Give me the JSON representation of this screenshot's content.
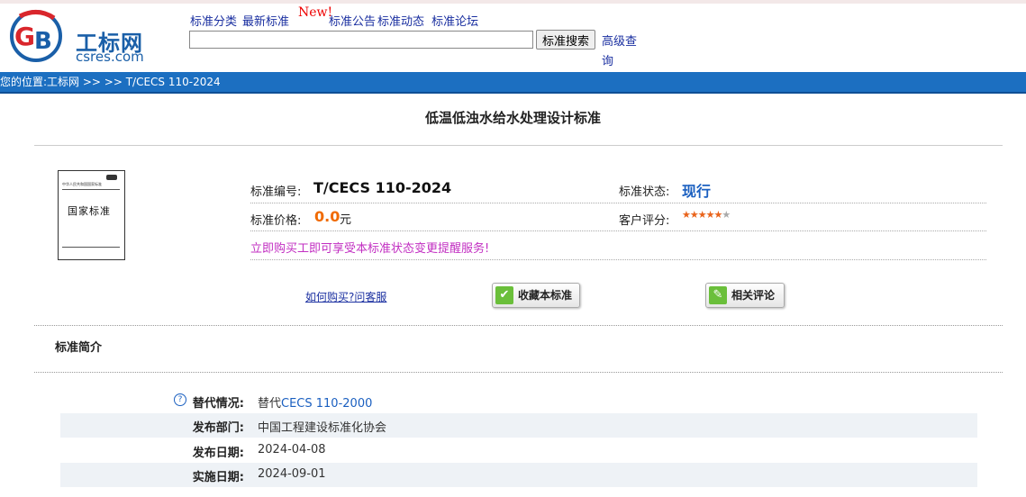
{
  "header": {
    "logo_text": "工标网",
    "logo_url": "csres.com",
    "nav": [
      "标准分类",
      "最新标准",
      "标准公告",
      "标准动态",
      "标准论坛"
    ],
    "new_badge": "New!",
    "search_value": "",
    "search_button": "标准搜索",
    "advanced_search": "高级查询"
  },
  "breadcrumb": "您的位置:工标网 >> >> T/CECS 110-2024",
  "page_title": "低温低浊水给水处理设计标准",
  "cover": {
    "header_text": "中华人民共和国国家标准",
    "big_text": "国家标准"
  },
  "info": {
    "code_label": "标准编号:",
    "code_value": "T/CECS 110-2024",
    "status_label": "标准状态:",
    "status_value": "现行",
    "price_label": "标准价格:",
    "price_value": "0.0",
    "price_unit": "元",
    "rating_label": "客户评分:",
    "rating": 4.5,
    "rating_max": 5,
    "promo": "立即购买工即可享受本标准状态变更提醒服务!"
  },
  "actions": {
    "how_to_buy": "如何购买?问客服",
    "favorite": "收藏本标准",
    "comments": "相关评论"
  },
  "section_title": "标准简介",
  "details": [
    {
      "label": "替代情况:",
      "prefix": "替代",
      "link": "CECS 110-2000"
    },
    {
      "label": "发布部门:",
      "value": "中国工程建设标准化协会"
    },
    {
      "label": "发布日期:",
      "value": "2024-04-08"
    },
    {
      "label": "实施日期:",
      "value": "2024-09-01"
    }
  ],
  "colors": {
    "brand_blue": "#1c6fc1",
    "price_orange": "#f06a00",
    "status_blue": "#1a5fc0",
    "promo_magenta": "#c22fc2"
  }
}
